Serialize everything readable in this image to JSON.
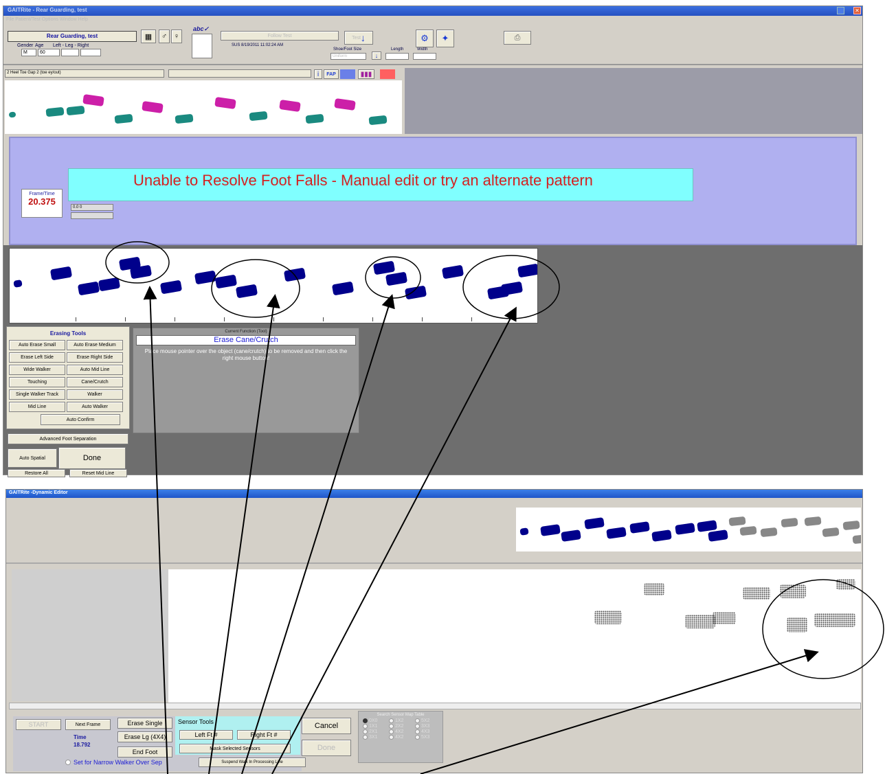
{
  "top": {
    "title": "GAITRite - Rear Guarding, test",
    "menubar": "File  Patient/Test  Options  Window  Help",
    "patient_name": "Rear Guarding, test",
    "gender_label": "Gender",
    "age_label": "Age",
    "leftleg_label": "Left - Leg - Right",
    "gender": "M",
    "age": "60",
    "center_btn": "Follow Test",
    "test_btn": "Test",
    "datetime": "SUS 8/19/2011 11:02:24 AM",
    "shoe_label": "Shoe/Foot Size",
    "length_label": "Length",
    "width_label": "Width",
    "shoe_value": "Uniform",
    "tab_label": "2 Heel Toe Gap 2 (toe ey/out)",
    "fap_label": "FAP",
    "frame_label": "Frame/Time",
    "frame_value": "20.375",
    "small_value": "0.0 0",
    "banner": "Unable to Resolve Foot Falls - Manual edit or try an alternate pattern",
    "erasing_title": "Erasing Tools",
    "erase_buttons": [
      "Auto Erase Small",
      "Auto Erase Medium",
      "Erase Left Side",
      "Erase Right Side",
      "Wide Walker",
      "Auto Mid Line",
      "Touching",
      "Cane/Crutch",
      "Single Walker Track",
      "Walker",
      "Mid Line",
      "Auto Walker"
    ],
    "auto_confirm": "Auto Confirm",
    "adv_sep": "Advanced Foot Separation",
    "auto_spatial": "Auto Spatial",
    "done": "Done",
    "restore_all": "Restore All",
    "reset_mid": "Reset Mid Line",
    "cf_label": "Current Function (Tool)",
    "cf_value": "Erase Cane/Crutch",
    "cf_instr": "Place mouse pointer over the object (cane/crutch) to be removed and then click the right mouse button!"
  },
  "bottom": {
    "title": "GAITRite -Dynamic Editor",
    "start": "START",
    "next_frame": "Next Frame",
    "time_label": "Time",
    "time_value": "18.792",
    "erase_single": "Erase Single",
    "erase_lg": "Erase Lg (4X4)",
    "end_foot": "End Foot",
    "sensor_tools": "Sensor Tools",
    "left_ft": "Left Ft #",
    "right_ft": "Right Ft #",
    "mask_selected": "Mask Selected Sensors",
    "cancel": "Cancel",
    "done": "Done",
    "suspend": "Suspend Walk In Processing Line",
    "narrow": "Set for Narrow Walker Over Sep",
    "search_label": "Search Sensor Map Table",
    "radios": [
      "0X0",
      "1X2",
      "5X2",
      "1X1",
      "2X2",
      "3X3",
      "2X1",
      "4X2",
      "4X3",
      "3X1",
      "4X2",
      "5X3"
    ]
  },
  "colors": {
    "blue_foot": "#00008b",
    "magenta": "#cc1fa8",
    "teal": "#1a8a80",
    "banner_bg": "#80ffff",
    "banner_fg": "#d42020",
    "panel": "#b0b0f0",
    "gray": "#777777",
    "titlebar": "#2a5fd6"
  }
}
